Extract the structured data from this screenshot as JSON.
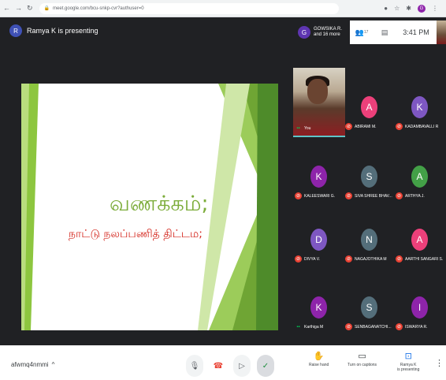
{
  "browser": {
    "url": "meet.google.com/bcu-snkp-cvr?authuser=0",
    "nav_icons": [
      "back-icon",
      "forward-icon",
      "reload-icon"
    ]
  },
  "meet_top": {
    "presenter_initial": "R",
    "presenter_text": "Ramya K is presenting",
    "people_initial": "G",
    "people_line1": "GOWSIKA R.",
    "people_line2": "and 16 more",
    "people_count": "17",
    "time": "3:41 PM"
  },
  "slide": {
    "line1": "வணக்கம்;",
    "line2": "நாட்டு நலப்பணித் திட்டம;"
  },
  "participants": [
    {
      "label": "You",
      "initial": "",
      "color": "",
      "mic": "on"
    },
    {
      "label": "ABIRAMI M.",
      "initial": "A",
      "color": "#ec407a",
      "mic": "off"
    },
    {
      "label": "KADAMBAVALLI R",
      "initial": "K",
      "color": "#7e57c2",
      "mic": "off"
    },
    {
      "label": "KALEESWARI G.",
      "initial": "K",
      "color": "#8e24aa",
      "mic": "off"
    },
    {
      "label": "SIVA SHREE BHAV...",
      "initial": "S",
      "color": "#546e7a",
      "mic": "off"
    },
    {
      "label": "ARTHYA J.",
      "initial": "A",
      "color": "#43a047",
      "mic": "off"
    },
    {
      "label": "DIVYA V.",
      "initial": "D",
      "color": "#7e57c2",
      "mic": "off"
    },
    {
      "label": "NAGAJOTHIKA M",
      "initial": "N",
      "color": "#546e7a",
      "mic": "off"
    },
    {
      "label": "AARTHI SANGARI S.",
      "initial": "A",
      "color": "#ec407a",
      "mic": "off"
    },
    {
      "label": "Karthiga M",
      "initial": "K",
      "color": "#8e24aa",
      "mic": "on"
    },
    {
      "label": "SENBAGANATCHI...",
      "initial": "S",
      "color": "#546e7a",
      "mic": "off"
    },
    {
      "label": "ISWARYA R.",
      "initial": "I",
      "color": "#8e24aa",
      "mic": "off"
    }
  ],
  "bottom": {
    "meeting_code": "afwmq4nmmi",
    "raise_hand": "Raise hand",
    "captions": "Turn on captions",
    "presenting_line1": "Ramya K",
    "presenting_line2": "is presenting"
  }
}
